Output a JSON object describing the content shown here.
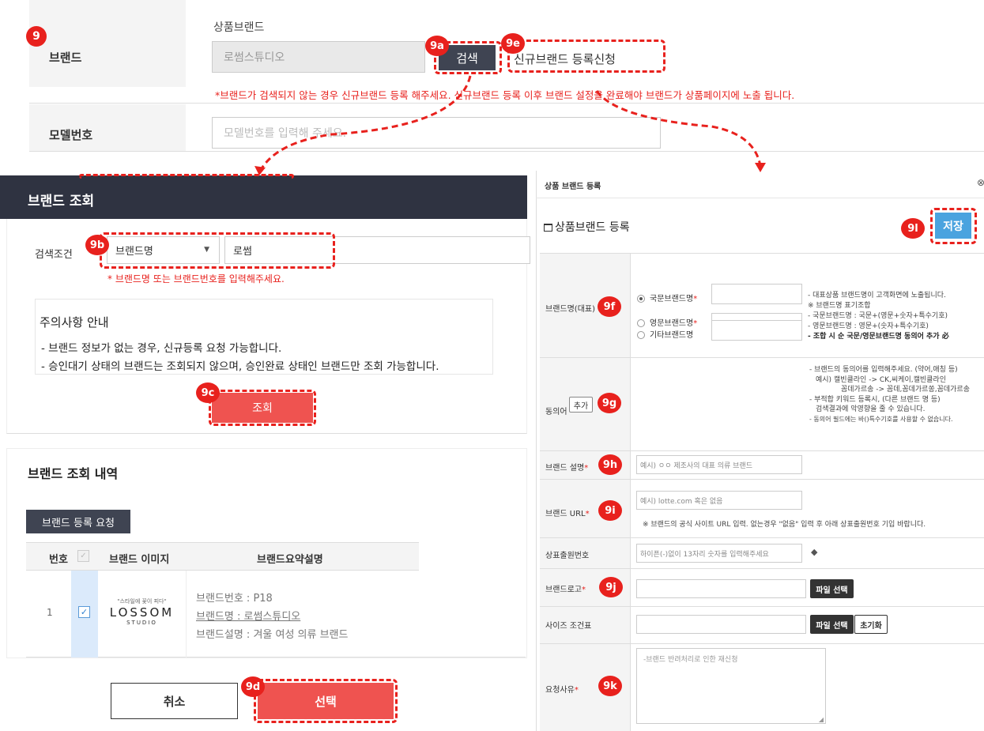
{
  "top_form": {
    "section_badge": "9",
    "brand_label": "브랜드",
    "product_brand_title": "상품브랜드",
    "brand_input_value": "로썸스튜디오",
    "search_badge": "9a",
    "search_button": "검색",
    "register_badge": "9e",
    "register_button": "신규브랜드 등록신청",
    "notice": "*브랜드가 검색되지 않는 경우 신규브랜드 등록 해주세요. 신규브랜드 등록 이후 브랜드 설정을 완료해야 브랜드가 상품페이지에 노출 됩니다.",
    "model_label": "모델번호",
    "model_placeholder": "모델번호를 입력해 주세요."
  },
  "brand_search": {
    "header": "브랜드 조회",
    "condition_label": "검색조건",
    "select_badge": "9b",
    "select_value": "브랜드명",
    "query_value": "로썸",
    "hint": "* 브랜드명 또는 브랜드번호를 입력해주세요.",
    "notice_title": "주의사항 안내",
    "notice_line1": "- 브랜드 정보가 없는 경우, 신규등록 요청 가능합니다.",
    "notice_line2": "- 승인대기 상태의 브랜드는 조회되지 않으며, 승인완료 상태인 브랜드만 조회 가능합니다.",
    "query_badge": "9c",
    "query_button": "조회"
  },
  "brand_results": {
    "header": "브랜드 조회 내역",
    "request_button": "브랜드 등록 요청",
    "columns": [
      "번호",
      "",
      "브랜드 이미지",
      "브랜드요약설명"
    ],
    "row": {
      "number": "1",
      "logo_tagline": "\"스타일에 꽃이 피다\"",
      "logo_main": "LOSSOM",
      "logo_sub": "STUDIO",
      "brand_no": "브랜드번호 : P18",
      "brand_name": "브랜드명 : 로썸스튜디오",
      "brand_desc": "브랜드설명 : 겨울 여성 의류 브랜드"
    },
    "cancel_button": "취소",
    "select_badge": "9d",
    "select_button": "선택"
  },
  "register_panel": {
    "window_title": "상품 브랜드 등록",
    "title": "상품브랜드 등록",
    "save_badge": "9l",
    "save_button": "저장",
    "brand_name_label": "브랜드명(대표)",
    "brand_name_badge": "9f",
    "radio_kor": "국문브랜드명",
    "radio_eng": "영문브랜드명",
    "radio_other": "기타브랜드명",
    "name_note1": "- 대표상품 브랜드명이 고객화면에 노출됩니다.",
    "name_note2": "※ 브랜드명 표기조합",
    "name_note3": "- 국문브랜드명 : 국문+(영문+숫자+특수기호)",
    "name_note4": "- 영문브랜드명 : 영문+(숫자+특수기호)",
    "name_note5": "- 조합 시 순 국문/영문브랜드명 동의어 추가 必",
    "synonym_label": "동의어",
    "synonym_add": "추가",
    "synonym_badge": "9g",
    "syn_note1": "- 브랜드의 동의어를 입력해주세요. (약어,애칭 등)",
    "syn_note2": "예시) 캘빈클라인 -> CK,씨케이,캘빈클라인",
    "syn_note3": "꼼데가르송 -> 꼼데,꼼데가르쏭,꼼데가르송",
    "syn_note4": "- 부적합 키워드 등록시, (다른 브랜드 명 등)",
    "syn_note5": "검색결과에 악영향을 줄 수 있습니다.",
    "syn_note6": "- 동의어 필드에는 바()특수기호를 사용할 수 없습니다.",
    "desc_label": "브랜드 설명",
    "desc_badge": "9h",
    "desc_placeholder": "예시) ㅇㅇ 제조사의 대표 의류 브랜드",
    "url_label": "브랜드 URL",
    "url_badge": "9i",
    "url_placeholder": "예시) lotte.com 혹은 없음",
    "url_note": "※ 브랜드의 공식 사이트 URL 입력. 없는경우 \"없음\" 입력 후 아래 상표출원번호 기입 바랍니다.",
    "trademark_label": "상표출원번호",
    "trademark_placeholder": "하이픈(-)없이 13자리 숫자를 입력해주세요",
    "logo_label": "브랜드로고",
    "logo_badge": "9j",
    "file_button": "파일 선택",
    "size_label": "사이즈 조건표",
    "reset_button": "초기화",
    "reason_label": "요청사유",
    "reason_badge": "9k",
    "reason_placeholder": "-브랜드 반려처리로 인한 재신청"
  }
}
